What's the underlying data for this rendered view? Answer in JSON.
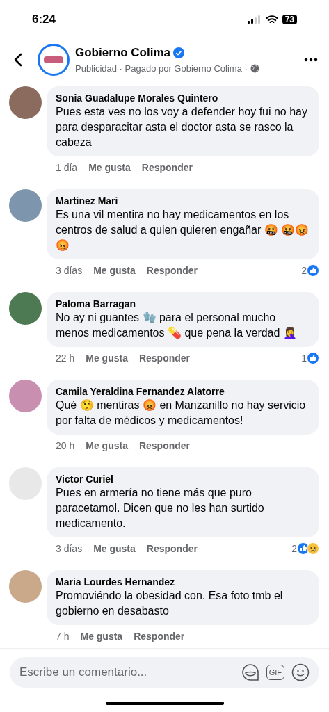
{
  "status_bar": {
    "time": "6:24",
    "battery": "73"
  },
  "header": {
    "page_name": "Gobierno Colima",
    "verified": true,
    "subtitle": "Publicidad · Pagado por Gobierno Colima ·"
  },
  "comments": [
    {
      "author": "Sonia Guadalupe Morales Quintero",
      "text": "Pues esta ves no los voy a defender hoy fui no hay para desparacitar asta el doctor asta se rasco la cabeza",
      "time": "1 día",
      "like": "Me gusta",
      "reply": "Responder"
    },
    {
      "author": "Martinez Mari",
      "text": "Es una vil mentira no hay medicamentos en los centros de salud a quien quieren engañar 🤬 🤬😡😡",
      "time": "3 días",
      "like": "Me gusta",
      "reply": "Responder",
      "reactions": {
        "count": "2",
        "icons": [
          {
            "kind": "like"
          }
        ]
      }
    },
    {
      "author": "Paloma Barragan",
      "text": "No ay ni guantes 🧤 para el personal mucho menos medicamentos 💊 que pena la verdad 🤦‍♀️",
      "time": "22 h",
      "like": "Me gusta",
      "reply": "Responder",
      "reactions": {
        "count": "1",
        "icons": [
          {
            "kind": "like"
          }
        ]
      }
    },
    {
      "author": "Camila Yeraldina Fernandez Alatorre",
      "text": "Qué 🤥 mentiras 😡 en Manzanillo no hay servicio por falta de médicos y medicamentos!",
      "time": "20 h",
      "like": "Me gusta",
      "reply": "Responder"
    },
    {
      "author": "Victor Curiel",
      "text": "Pues en armería no tiene más que puro paracetamol. Dicen que no les han surtido medicamento.",
      "time": "3 días",
      "like": "Me gusta",
      "reply": "Responder",
      "reactions": {
        "count": "2",
        "icons": [
          {
            "kind": "like"
          },
          {
            "kind": "sad"
          }
        ]
      }
    },
    {
      "author": "Maria Lourdes Hernandez",
      "text": "Promoviéndo la obesidad con. Esa foto tmb el gobierno en desabasto",
      "time": "7 h",
      "like": "Me gusta",
      "reply": "Responder"
    }
  ],
  "composer": {
    "placeholder": "Escribe un comentario...",
    "gif_label": "GIF"
  }
}
